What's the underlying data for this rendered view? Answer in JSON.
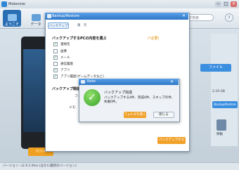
{
  "app": {
    "title": "Mobonize",
    "toolbar": {
      "welcome": "ようこそ",
      "data": "データ",
      "search_placeholder": "データ検索",
      "help": "?"
    },
    "window_controls": {
      "minimize": "−",
      "maximize": "□",
      "close": "✕"
    },
    "right_panel": {
      "file_button": "ファイル",
      "capacity": "2.19 GB",
      "backup_restore_button": "Backup/Restore",
      "move_label": "移動"
    },
    "bottom_button": "デバイ",
    "status": {
      "version": "バージョン: v2.0.1.9ms (ほかに最新のバージョン)"
    }
  },
  "backup_window": {
    "title": "Backup/Restore",
    "close": "✕",
    "tabs": [
      "バックアップ",
      "復　元"
    ],
    "section_select": "バックアップするPCの内容を選ぶ",
    "required": "(*必要)",
    "items": [
      {
        "label": "連絡先",
        "checked": true
      },
      {
        "label": "画像",
        "checked": false
      },
      {
        "label": "メール",
        "checked": true
      },
      {
        "label": "通信履歴",
        "checked": false
      },
      {
        "label": "アプリ",
        "checked": true
      },
      {
        "label": "アプリ履歴(ゲームデータなど)",
        "checked": true
      }
    ],
    "section_destination": "バックアップ関連設",
    "folder_label": "フォルダー:",
    "memo_label": "メモ:",
    "backup_button": "バックアップする"
  },
  "note_dialog": {
    "title": "Note",
    "close": "✕",
    "heading": "バックアップ完成",
    "message": "バックアップする4件、完成4件、スキップの件、失敗0件。",
    "confirm_button": "フォルダを開く",
    "close_button": "閉じる"
  }
}
